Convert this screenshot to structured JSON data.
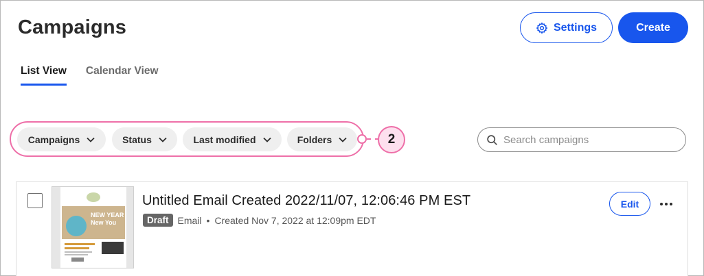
{
  "header": {
    "title": "Campaigns",
    "settings_label": "Settings",
    "create_label": "Create"
  },
  "tabs": [
    {
      "label": "List View",
      "active": true
    },
    {
      "label": "Calendar View",
      "active": false
    }
  ],
  "filters": [
    {
      "label": "Campaigns"
    },
    {
      "label": "Status"
    },
    {
      "label": "Last modified"
    },
    {
      "label": "Folders"
    }
  ],
  "callout": {
    "number": "2"
  },
  "search": {
    "placeholder": "Search campaigns",
    "value": ""
  },
  "campaigns": [
    {
      "title": "Untitled Email Created 2022/11/07, 12:06:46 PM EST",
      "status": "Draft",
      "type": "Email",
      "separator": "•",
      "created": "Created Nov 7, 2022 at 12:09pm EDT",
      "edit_label": "Edit",
      "thumbnail_text": "NEW YEAR New You"
    }
  ],
  "colors": {
    "accent": "#1856ed",
    "highlight": "#ee6fa8",
    "badge": "#666666"
  },
  "icons": {
    "settings": "gear-icon",
    "search": "search-icon",
    "chevron": "chevron-down-icon",
    "more": "more-horizontal-icon"
  }
}
